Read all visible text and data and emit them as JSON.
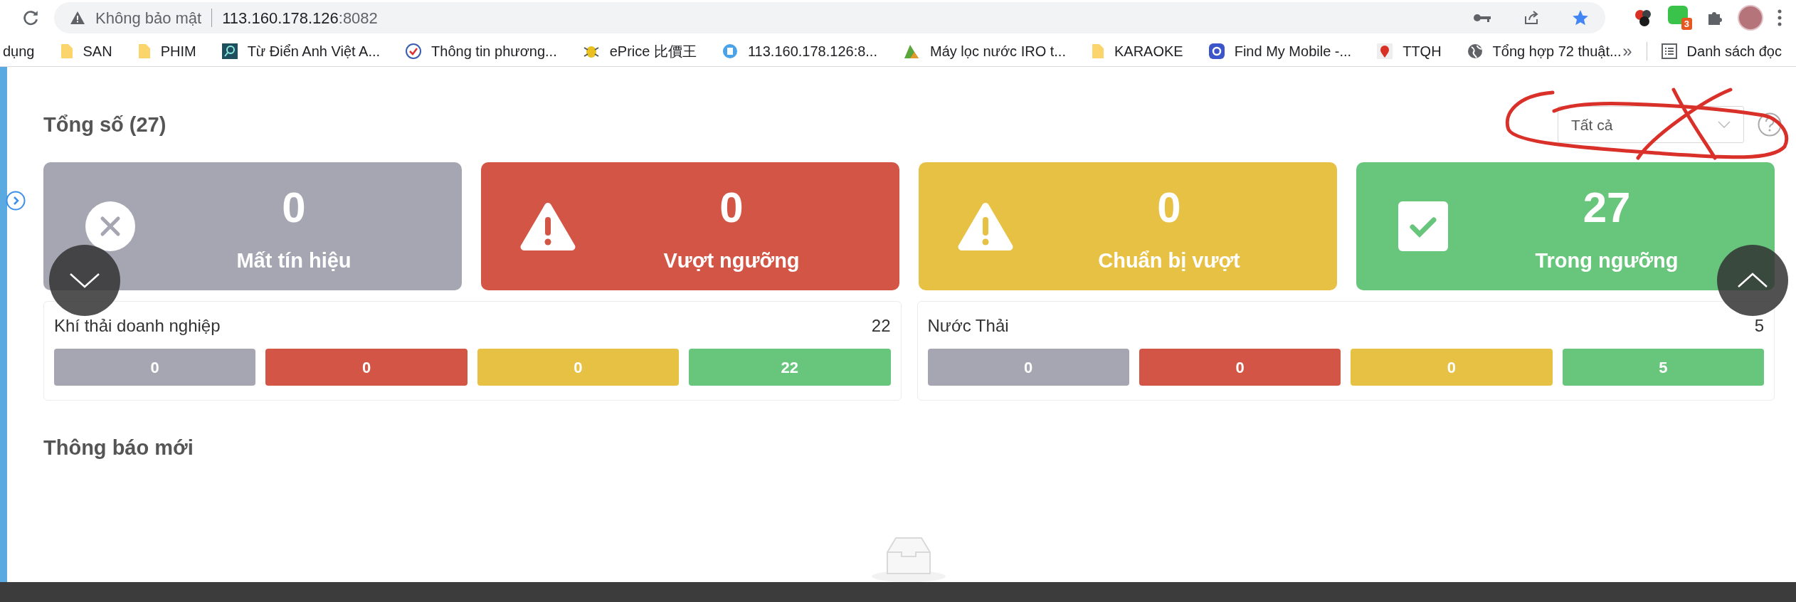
{
  "browser": {
    "security_label": "Không bảo mật",
    "url_host": "113.160.178.126",
    "url_port": ":8082",
    "extension_badge": "3",
    "bookmarks": [
      {
        "label": "dụng"
      },
      {
        "label": "SAN"
      },
      {
        "label": "PHIM"
      },
      {
        "label": "Từ Điển Anh Việt A..."
      },
      {
        "label": "Thông tin phương..."
      },
      {
        "label": "ePrice 比價王"
      },
      {
        "label": "113.160.178.126:8..."
      },
      {
        "label": "Máy lọc nước IRO t..."
      },
      {
        "label": "KARAOKE"
      },
      {
        "label": "Find My Mobile -..."
      },
      {
        "label": "TTQH"
      },
      {
        "label": "Tổng hợp 72 thuật..."
      }
    ],
    "bookmarks_overflow": "»",
    "reading_list": "Danh sách đọc"
  },
  "page": {
    "title": "Tổng số (27)",
    "filter": {
      "value": "Tất cả"
    },
    "status_cards": [
      {
        "kind": "lost",
        "count": "0",
        "label": "Mất tín hiệu"
      },
      {
        "kind": "over",
        "count": "0",
        "label": "Vượt ngưỡng"
      },
      {
        "kind": "near",
        "count": "0",
        "label": "Chuẩn bị vượt"
      },
      {
        "kind": "ok",
        "count": "27",
        "label": "Trong ngưỡng"
      }
    ],
    "groups": [
      {
        "name": "Khí thải doanh nghiệp",
        "total": "22",
        "counts": [
          {
            "kind": "lost",
            "value": "0"
          },
          {
            "kind": "over",
            "value": "0"
          },
          {
            "kind": "near",
            "value": "0"
          },
          {
            "kind": "ok",
            "value": "22"
          }
        ]
      },
      {
        "name": "Nước Thải",
        "total": "5",
        "counts": [
          {
            "kind": "lost",
            "value": "0"
          },
          {
            "kind": "over",
            "value": "0"
          },
          {
            "kind": "near",
            "value": "0"
          },
          {
            "kind": "ok",
            "value": "5"
          }
        ]
      }
    ],
    "notifications_title": "Thông báo mới"
  }
}
